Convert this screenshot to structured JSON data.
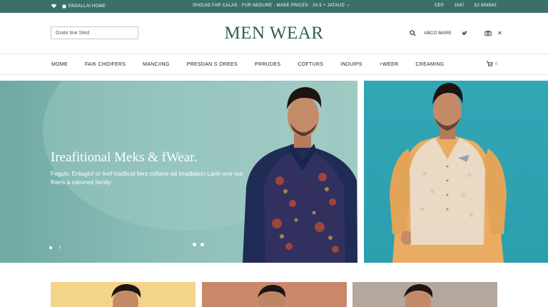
{
  "topbar": {
    "left_text": "ENSALLAI HOME",
    "center_text": "SHOUID FAR CALAS · FUR NEDURE · MAKE PRICES · 24.5 + JATAUD",
    "right_items": [
      "CEP",
      "1047",
      "£2 804842"
    ]
  },
  "header": {
    "search": {
      "value": "Grate tine Sted"
    },
    "logo": "MEN WEAR",
    "account_label": "ABCO MARE"
  },
  "nav": {
    "items": [
      "MOME",
      "FAIK CHOIFERS",
      "MANCIING",
      "PRESDAN S OREES",
      "PRRUDES",
      "COFTURS",
      "INDUIPS",
      "+WEER",
      "CREAMING"
    ],
    "cart_count": "0"
  },
  "hero": {
    "title": "Ireafitional Meks & fWear.",
    "subtitle": "Fegulv. Enlaglof or lnof tradtical llers collans ad trradlation Lanh one our lhiers a canvred family."
  },
  "colors": {
    "topbar": "#3b706a",
    "logo": "#2f5f58",
    "hero_bg": "#8cbeb8",
    "side_banner_bg": "#2b9fae"
  },
  "icons": [
    "heart-icon",
    "home-icon",
    "search-icon",
    "twitter-icon",
    "camera-icon",
    "close-icon",
    "cart-icon",
    "chevron-right-icon"
  ]
}
